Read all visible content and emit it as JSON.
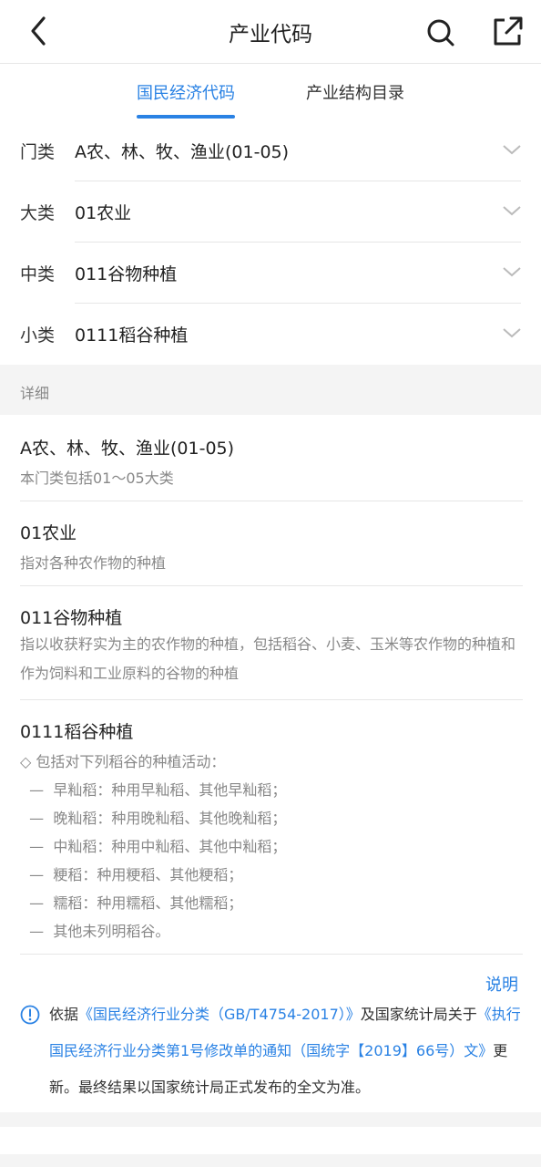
{
  "header": {
    "title": "产业代码"
  },
  "tabs": [
    {
      "label": "国民经济代码"
    },
    {
      "label": "产业结构目录"
    }
  ],
  "selectors": [
    {
      "label": "门类",
      "value": "A农、林、牧、渔业(01-05)"
    },
    {
      "label": "大类",
      "value": "01农业"
    },
    {
      "label": "中类",
      "value": "011谷物种植"
    },
    {
      "label": "小类",
      "value": "0111稻谷种植"
    }
  ],
  "section": {
    "label": "详细"
  },
  "details": [
    {
      "title": "A农、林、牧、渔业(01-05)",
      "desc": "本门类包括01～05大类"
    },
    {
      "title": "01农业",
      "desc": "指对各种农作物的种植"
    },
    {
      "title": "011谷物种植",
      "desc": "指以收获籽实为主的农作物的种植，包括稻谷、小麦、玉米等农作物的种植和作为饲料和工业原料的谷物的种植"
    },
    {
      "title": "0111稻谷种植",
      "lines": [
        "◇  包括对下列稻谷的种植活动：",
        "  —  早籼稻：种用早籼稻、其他早籼稻；",
        "  —  晚籼稻：种用晚籼稻、其他晚籼稻；",
        "  —  中籼稻：种用中籼稻、其他中籼稻；",
        "  —  粳稻：种用粳稻、其他粳稻；",
        "  —  糯稻：种用糯稻、其他糯稻；",
        "  —  其他未列明稻谷。"
      ]
    }
  ],
  "explain": {
    "label": "说明"
  },
  "note": {
    "prefix": "依据",
    "link1": "《国民经济行业分类（GB/T4754-2017）》",
    "mid": "及国家统计局关于",
    "link2": "《执行国民经济行业分类第1号修改单的通知（国统字【2019】66号）文》",
    "suffix": "更新。最终结果以国家统计局正式发布的全文为准。"
  },
  "colors": {
    "accent": "#2a82e4"
  }
}
